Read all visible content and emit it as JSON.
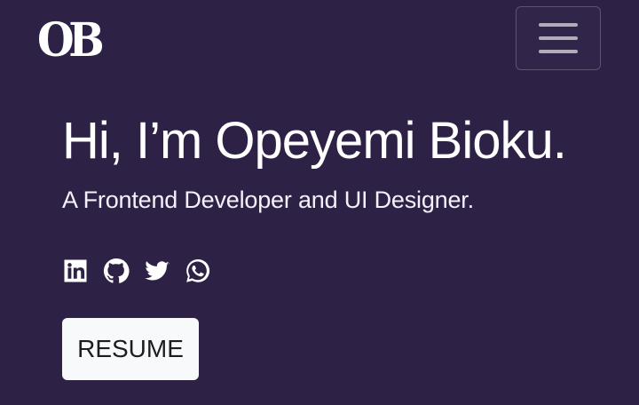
{
  "header": {
    "logo_text": "OB",
    "menu_icon": "hamburger-icon"
  },
  "hero": {
    "title": "Hi, I’m Opeyemi Bioku.",
    "subtitle": "A Frontend Developer and UI Designer."
  },
  "socials": [
    {
      "icon": "linkedin-icon"
    },
    {
      "icon": "github-icon"
    },
    {
      "icon": "twitter-icon"
    },
    {
      "icon": "whatsapp-icon"
    }
  ],
  "actions": {
    "resume_label": "RESUME"
  },
  "colors": {
    "background": "#2d2146",
    "text": "#ffffff",
    "button_background": "#f8f9fb",
    "button_text": "#1d1d1f"
  }
}
